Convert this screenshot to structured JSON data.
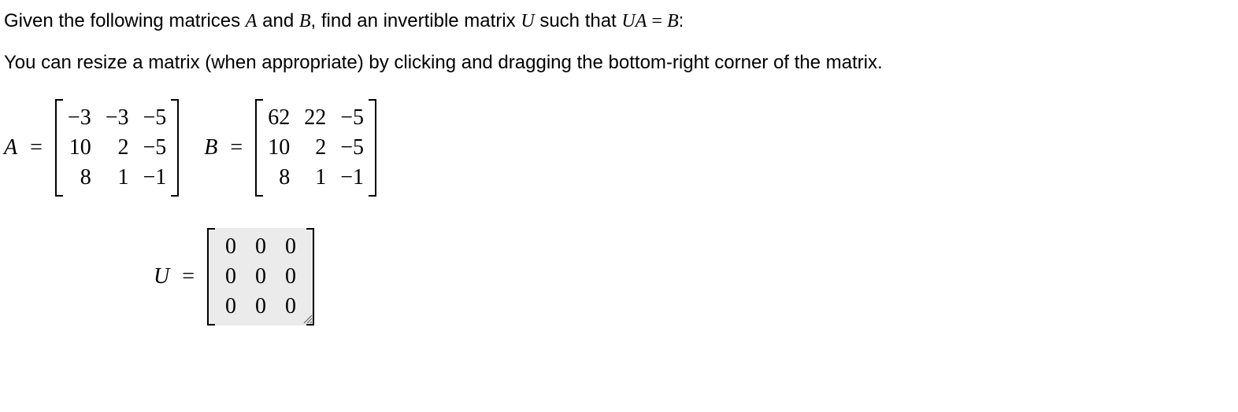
{
  "problem": {
    "line1_pre": "Given the following matrices ",
    "varA": "A",
    "line1_mid1": " and ",
    "varB": "B",
    "line1_mid2": ", find an invertible matrix ",
    "varU": "U",
    "line1_mid3": " such that ",
    "equation": "UA = B",
    "line1_end": ":",
    "line2": "You can resize a matrix (when appropriate) by clicking and dragging the bottom-right corner of the matrix."
  },
  "matrices": {
    "A": {
      "label": "A",
      "eq": "=",
      "cells": [
        "−3",
        "−3",
        "−5",
        "10",
        "2",
        "−5",
        "8",
        "1",
        "−1"
      ]
    },
    "B": {
      "label": "B",
      "eq": "=",
      "cells": [
        "62",
        "22",
        "−5",
        "10",
        "2",
        "−5",
        "8",
        "1",
        "−1"
      ]
    },
    "U": {
      "label": "U",
      "eq": "=",
      "cells": [
        "0",
        "0",
        "0",
        "0",
        "0",
        "0",
        "0",
        "0",
        "0"
      ]
    }
  }
}
